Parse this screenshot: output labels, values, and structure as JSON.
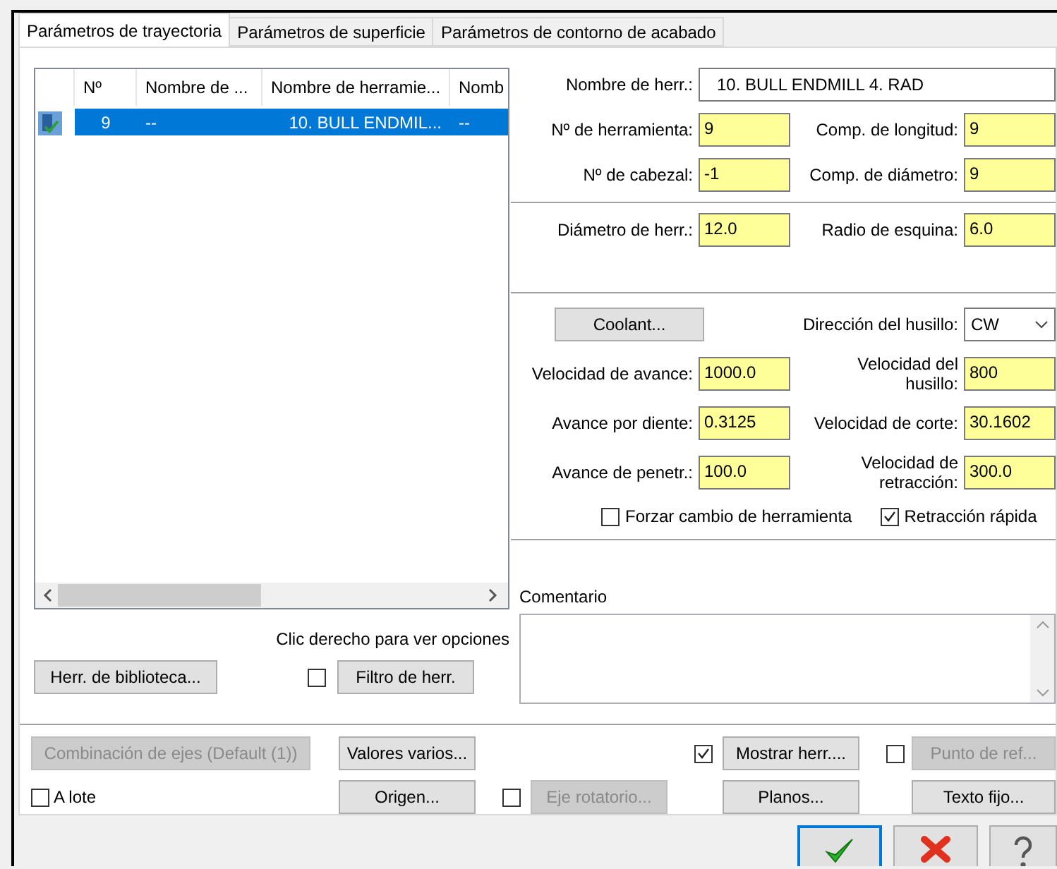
{
  "tabs": [
    {
      "label": "Parámetros de trayectoria",
      "selected": true
    },
    {
      "label": "Parámetros de superficie",
      "selected": false
    },
    {
      "label": "Parámetros de contorno de acabado",
      "selected": false
    }
  ],
  "tool_list": {
    "columns": [
      "Nº",
      "Nombre de ...",
      "Nombre de herramie...",
      "Nomb"
    ],
    "rows": [
      {
        "selected": true,
        "cells": [
          "9",
          "--",
          "10. BULL ENDMIL...",
          "--"
        ]
      }
    ]
  },
  "hint": "Clic derecho para ver opciones",
  "library_button": "Herr. de biblioteca...",
  "filter": {
    "checked": false,
    "button": "Filtro de herr."
  },
  "tool_name": {
    "label": "Nombre de herr.:",
    "value": "10. BULL ENDMILL 4. RAD"
  },
  "tool_fields": [
    {
      "label": "Nº de herramienta:",
      "value": "9"
    },
    {
      "label": "Comp. de longitud:",
      "value": "9"
    },
    {
      "label": "Nº de cabezal:",
      "value": "-1"
    },
    {
      "label": "Comp. de diámetro:",
      "value": "9"
    }
  ],
  "geometry_fields": [
    {
      "label": "Diámetro de herr.:",
      "value": "12.0"
    },
    {
      "label": "Radio de esquina:",
      "value": "6.0"
    }
  ],
  "coolant_button": "Coolant...",
  "spindle_direction": {
    "label": "Dirección del husillo:",
    "value": "CW"
  },
  "feed_fields": [
    {
      "label": "Velocidad de avance:",
      "value": "1000.0"
    },
    {
      "label": "Velocidad del\nhusillo:",
      "value": "800"
    },
    {
      "label": "Avance por diente:",
      "value": "0.3125"
    },
    {
      "label": "Velocidad de corte:",
      "value": "30.1602"
    },
    {
      "label": "Avance de penetr.:",
      "value": "100.0"
    },
    {
      "label": "Velocidad de\nretracción:",
      "value": "300.0"
    }
  ],
  "options": [
    {
      "label": "Forzar cambio de herramienta",
      "checked": false
    },
    {
      "label": "Retracción rápida",
      "checked": true
    }
  ],
  "comment": {
    "label": "Comentario"
  },
  "bottom_rows": [
    [
      {
        "kind": "button",
        "label": "Combinación de ejes (Default (1))",
        "disabled": true
      },
      {
        "kind": "button",
        "label": "Valores varios...",
        "disabled": false
      },
      {
        "kind": "checkbox",
        "checked": true
      },
      {
        "kind": "button",
        "label": "Mostrar herr....",
        "disabled": false
      },
      {
        "kind": "checkbox",
        "checked": false
      },
      {
        "kind": "button",
        "label": "Punto de ref...",
        "disabled": true
      }
    ],
    [
      {
        "kind": "checkbox",
        "checked": false,
        "label": "A lote"
      },
      {
        "kind": "button",
        "label": "Origen...",
        "disabled": false
      },
      {
        "kind": "checkbox",
        "checked": false
      },
      {
        "kind": "button",
        "label": "Eje rotatorio...",
        "disabled": true
      },
      {
        "kind": "button",
        "label": "Planos...",
        "disabled": false
      },
      {
        "kind": "button",
        "label": "Texto fijo...",
        "disabled": false
      }
    ]
  ],
  "dialog_buttons": [
    {
      "kind": "ok"
    },
    {
      "kind": "cancel"
    },
    {
      "kind": "help"
    }
  ]
}
